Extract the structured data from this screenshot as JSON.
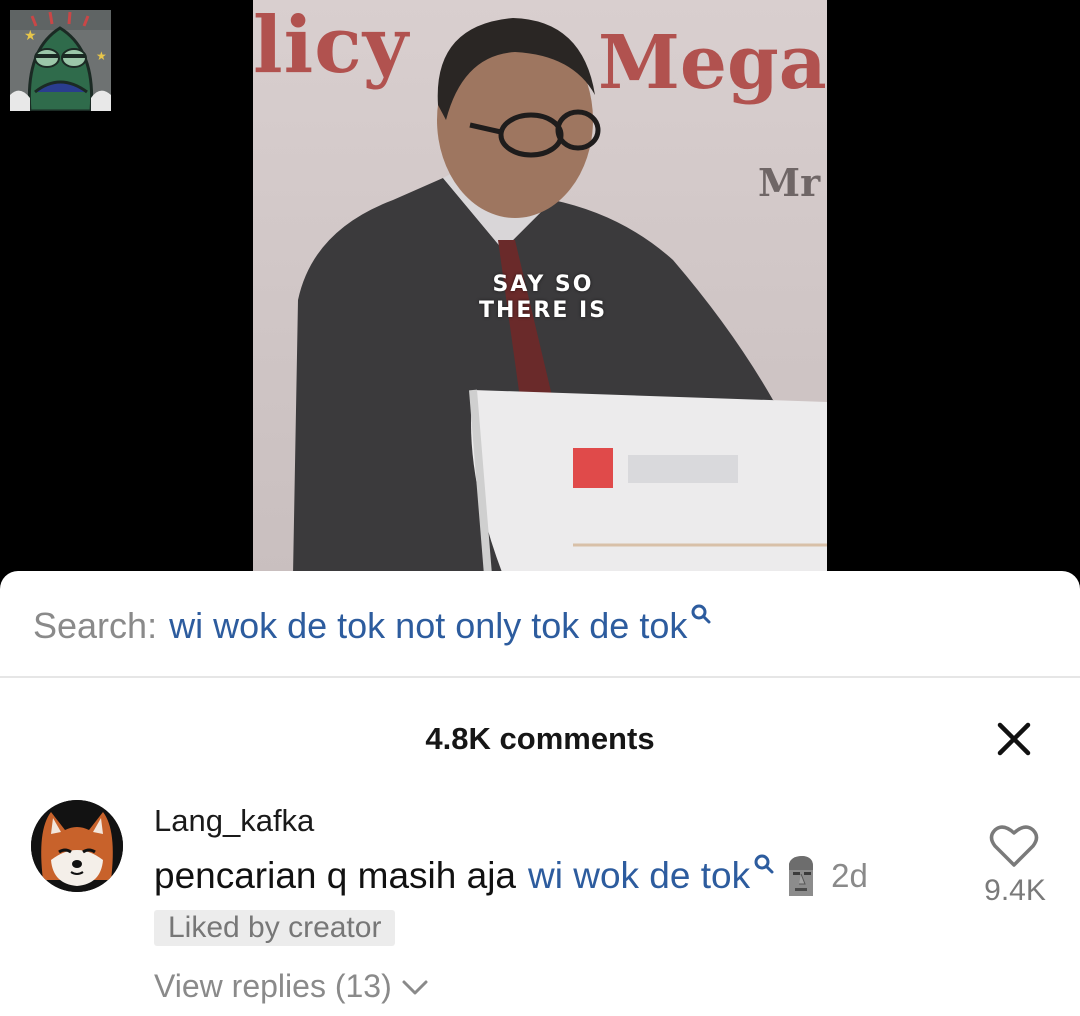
{
  "video": {
    "background_text": [
      "licy",
      "Mega",
      "Mr"
    ],
    "caption_line1": "SAY SO",
    "caption_line2": "THERE IS"
  },
  "search": {
    "prefix": "Search:",
    "query": "wi wok de tok not only tok de tok",
    "icon": "search-icon"
  },
  "comments_header": {
    "count_label": "4.8K comments",
    "close_icon": "close-icon"
  },
  "comment": {
    "username": "Lang_kafka",
    "text_plain": "pencarian q masih aja",
    "text_link": "wi wok de tok",
    "emoji": "moai",
    "time": "2d",
    "likes": "9.4K",
    "badge": "Liked by creator",
    "view_replies": "View replies (13)"
  },
  "colors": {
    "link": "#2d5c9e",
    "muted": "#8a8a8a",
    "sheet_bg": "#ffffff",
    "video_bg": "#000000"
  }
}
